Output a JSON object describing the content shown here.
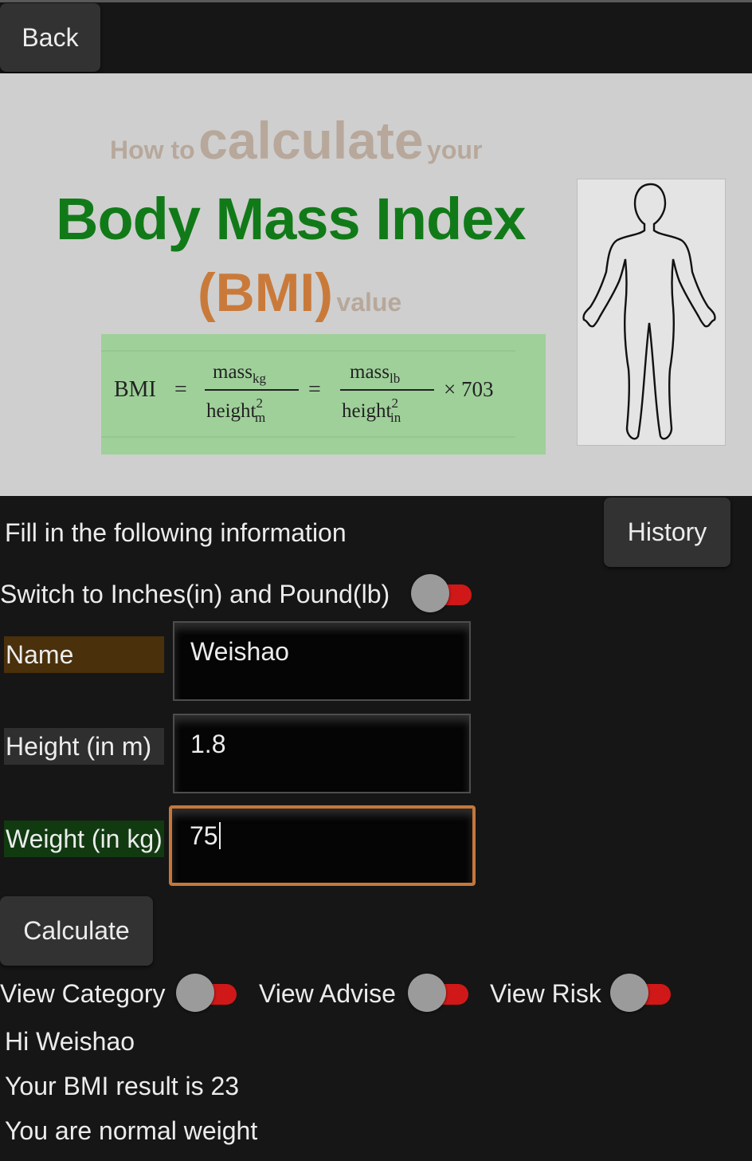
{
  "header": {
    "back_label": "Back"
  },
  "banner": {
    "line1_prefix": "How to",
    "line1_main": "calculate",
    "line1_suffix": "your",
    "title": "Body Mass Index",
    "abbr": "(BMI)",
    "abbr_suffix": "value",
    "formula": {
      "lhs": "BMI",
      "eq": "=",
      "num1": "mass",
      "num1_sub": "kg",
      "den1": "height",
      "den1_sup": "2",
      "den1_sub": "m",
      "num2": "mass",
      "num2_sub": "lb",
      "den2": "height",
      "den2_sup": "2",
      "den2_sub": "in",
      "multiplier": "× 703"
    }
  },
  "form": {
    "instruction": "Fill in the following information",
    "history_label": "History",
    "unit_switch_label": "Switch to Inches(in) and Pound(lb)",
    "fields": [
      {
        "label": "Name",
        "value": "Weishao"
      },
      {
        "label": "Height (in m)",
        "value": "1.8"
      },
      {
        "label": "Weight (in kg)",
        "value": "75"
      }
    ],
    "calculate_label": "Calculate"
  },
  "toggles": {
    "category_label": "View Category",
    "advise_label": "View Advise",
    "risk_label": "View Risk"
  },
  "results": {
    "greeting": "Hi Weishao",
    "bmi_prefix": "Your BMI result is",
    "bmi_value": "23",
    "status": "You are normal weight"
  },
  "colors": {
    "background": "#161616",
    "button": "#323232",
    "toggle_track": "#d01818",
    "toggle_thumb": "#9b9b9b",
    "name_label_bg": "#4a300b",
    "height_label_bg": "#2f2f2f",
    "weight_label_bg": "#113a10",
    "focus_border": "#c5773b",
    "banner_title": "#117a18",
    "banner_bmi": "#c97a3a"
  }
}
